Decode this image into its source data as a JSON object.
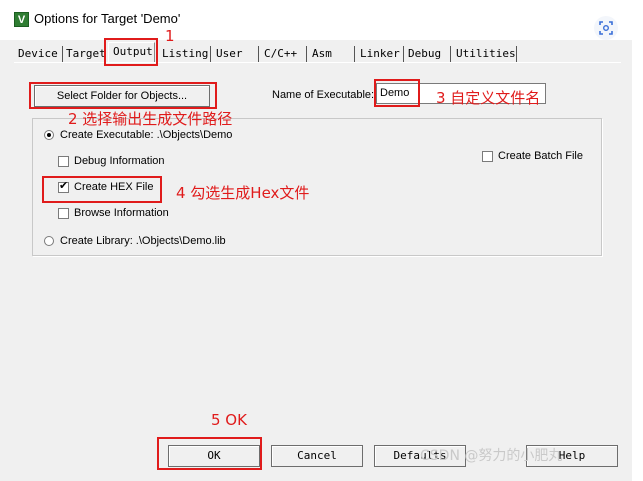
{
  "window": {
    "title": "Options for Target 'Demo'"
  },
  "tabs": [
    {
      "label": "Device"
    },
    {
      "label": "Target"
    },
    {
      "label": "Output"
    },
    {
      "label": "Listing"
    },
    {
      "label": "User"
    },
    {
      "label": "C/C++"
    },
    {
      "label": "Asm"
    },
    {
      "label": "Linker"
    },
    {
      "label": "Debug"
    },
    {
      "label": "Utilities"
    }
  ],
  "output": {
    "select_folder_label": "Select Folder for Objects...",
    "name_label": "Name of Executable:",
    "name_value": "Demo",
    "create_executable_label": "Create Executable:  .\\Objects\\Demo",
    "debug_info_label": "Debug Information",
    "create_hex_label": "Create HEX File",
    "browse_info_label": "Browse Information",
    "create_library_label": "Create Library:  .\\Objects\\Demo.lib",
    "create_batch_label": "Create Batch File",
    "create_executable_selected": true,
    "debug_info_checked": false,
    "create_hex_checked": true,
    "browse_info_checked": false,
    "create_batch_checked": false
  },
  "annotations": {
    "a1": "1",
    "a2": "2 选择输出生成文件路径",
    "a3": "3 自定义文件名",
    "a4": "4 勾选生成Hex文件",
    "a5": "5 OK",
    "color": "#e01b1b"
  },
  "buttons": {
    "ok": "OK",
    "cancel": "Cancel",
    "defaults": "Defaults",
    "help": "Help"
  },
  "watermark": "CSDN @努力的小肥丸",
  "icons": {
    "app": "keil-uvision-icon",
    "corner": "screenshot-icon"
  }
}
